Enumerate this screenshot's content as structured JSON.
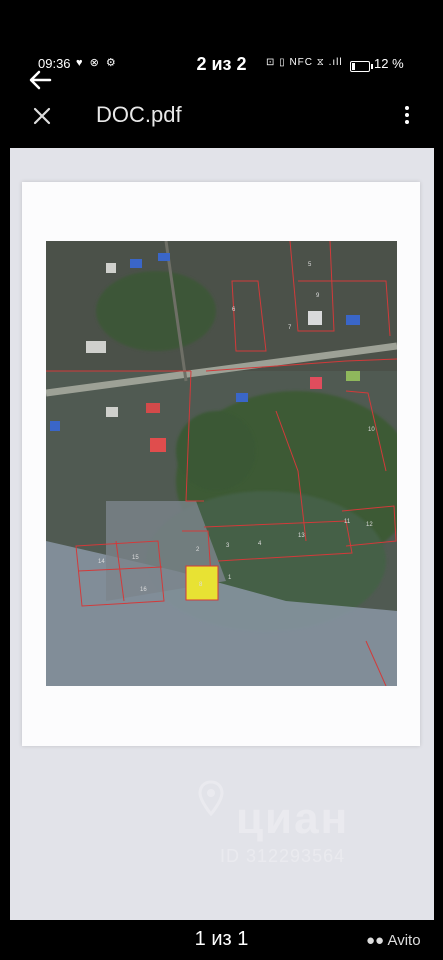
{
  "status_bar": {
    "time": "09:36",
    "left_icons": "♥ ⊗ ⚙",
    "page_indicator": "2 из 2",
    "right_icons": "⊡ ▯ NFC ⧖ .ıll",
    "battery": "12 %"
  },
  "toolbar": {
    "title": "DOC.pdf"
  },
  "watermark": {
    "brand": "циан",
    "id": "ID 312293564"
  },
  "map": {
    "highlight_color": "#e8e233",
    "boundary_color": "#d23a3a",
    "plots": [
      "8",
      "5",
      "6",
      "7",
      "9",
      "10",
      "11",
      "12",
      "13",
      "4",
      "3",
      "2",
      "1",
      "14",
      "15",
      "16"
    ]
  },
  "footer": {
    "page_counter": "1 из 1",
    "avito_label": "Avito"
  }
}
